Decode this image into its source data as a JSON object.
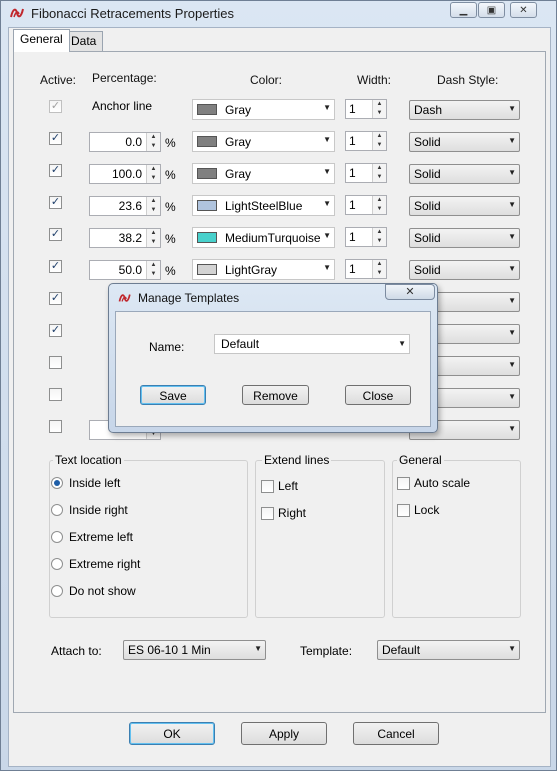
{
  "window": {
    "title": "Fibonacci Retracements Properties"
  },
  "tabs": [
    "General",
    "Data"
  ],
  "headers": {
    "active": "Active:",
    "percentage": "Percentage:",
    "color": "Color:",
    "width": "Width:",
    "dash_style": "Dash Style:"
  },
  "anchor": {
    "label": "Anchor line",
    "checked": true,
    "disabled": true,
    "color": "Gray",
    "swatch": "#808080",
    "width": "1",
    "dash": "Dash"
  },
  "rows": [
    {
      "checked": true,
      "percent": "0.0",
      "unit": "%",
      "color": "Gray",
      "swatch": "#808080",
      "width": "1",
      "dash": "Solid"
    },
    {
      "checked": true,
      "percent": "100.0",
      "unit": "%",
      "color": "Gray",
      "swatch": "#808080",
      "width": "1",
      "dash": "Solid"
    },
    {
      "checked": true,
      "percent": "23.6",
      "unit": "%",
      "color": "LightSteelBlue",
      "swatch": "#b0c4de",
      "width": "1",
      "dash": "Solid"
    },
    {
      "checked": true,
      "percent": "38.2",
      "unit": "%",
      "color": "MediumTurquoise",
      "swatch": "#48d1cc",
      "width": "1",
      "dash": "Solid"
    },
    {
      "checked": true,
      "percent": "50.0",
      "unit": "%",
      "color": "LightGray",
      "swatch": "#d3d3d3",
      "width": "1",
      "dash": "Solid"
    },
    {
      "checked": true
    },
    {
      "checked": true
    },
    {
      "checked": false
    },
    {
      "checked": false
    },
    {
      "checked": false
    }
  ],
  "text_location": {
    "title": "Text location",
    "options": [
      "Inside left",
      "Inside right",
      "Extreme left",
      "Extreme right",
      "Do not show"
    ],
    "selected": "Inside left"
  },
  "extend_lines": {
    "title": "Extend lines",
    "left": "Left",
    "right": "Right"
  },
  "general_group": {
    "title": "General",
    "auto_scale": "Auto scale",
    "lock": "Lock"
  },
  "attach": {
    "label": "Attach to:",
    "value": "ES 06-10 1 Min"
  },
  "template": {
    "label": "Template:",
    "value": "Default"
  },
  "buttons": {
    "ok": "OK",
    "apply": "Apply",
    "cancel": "Cancel"
  },
  "manage_templates": {
    "title": "Manage Templates",
    "name_label": "Name:",
    "name_value": "Default",
    "save": "Save",
    "remove": "Remove",
    "close": "Close"
  },
  "icons": {
    "app": "ninja-logo-icon",
    "minimize": "minimize-icon",
    "maximize": "maximize-icon",
    "close": "close-icon"
  }
}
